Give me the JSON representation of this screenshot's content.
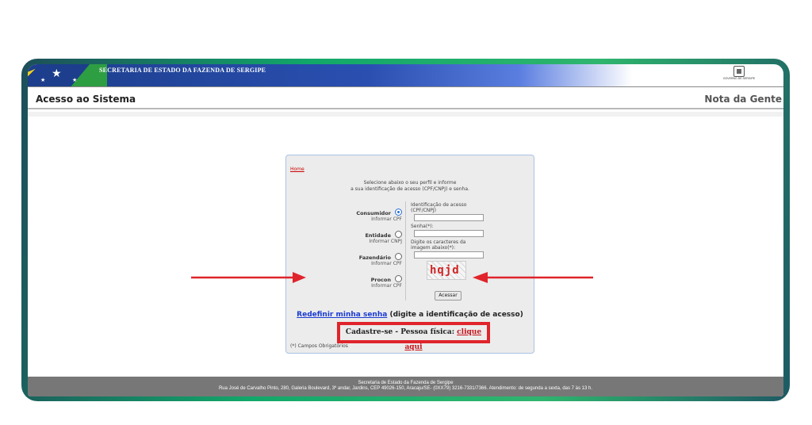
{
  "header": {
    "secretaria": "SECRETARIA DE ESTADO DA FAZENDA DE SERGIPE",
    "page_title": "Acesso ao Sistema",
    "brand": "Nota da Gente",
    "gov_logo_text": "GOVERNO DE SERGIPE"
  },
  "login": {
    "home_link": "Home",
    "intro_line1": "Selecione abaixo o seu perfil e informe",
    "intro_line2": "a sua identificação de acesso (CPF/CNPJ) e senha.",
    "profiles": [
      {
        "name": "Consumidor",
        "sub": "Informar CPF",
        "selected": true
      },
      {
        "name": "Entidade",
        "sub": "Informar CNPJ",
        "selected": false
      },
      {
        "name": "Fazendário",
        "sub": "Informar CPF",
        "selected": false
      },
      {
        "name": "Procon",
        "sub": "Informar CPF",
        "selected": false
      }
    ],
    "id_label_line1": "Identificação de acesso",
    "id_label_line2": "(CPF/CNPJ)",
    "senha_label": "Senha(*):",
    "captcha_label_line1": "Digite os caracteres da",
    "captcha_label_line2": "imagem abaixo(*):",
    "captcha_text": "hqjd",
    "submit_label": "Acessar",
    "reset_link": "Redefinir minha senha",
    "reset_hint": " (digite a identificação de acesso)",
    "register_text": "Cadastre-se - Pessoa física: ",
    "register_link": "clique aqui",
    "required_note": "(*) Campos Obrigatórios"
  },
  "footer": {
    "line1": "Secretaria de Estado da Fazenda de Sergipe",
    "line2": "Rua José de Carvalho Pinto, 280, Galeria Boulevard, 3º andar, Jardins, CEP 49026-150, Aracaju/SE- (0XX79) 3216-7331/7366. Atendimento: de segunda a sexta, das 7 às 13 h."
  },
  "colors": {
    "highlight_red": "#e0242b",
    "frame_green": "#12a86a",
    "link_blue": "#1a3bd1"
  }
}
